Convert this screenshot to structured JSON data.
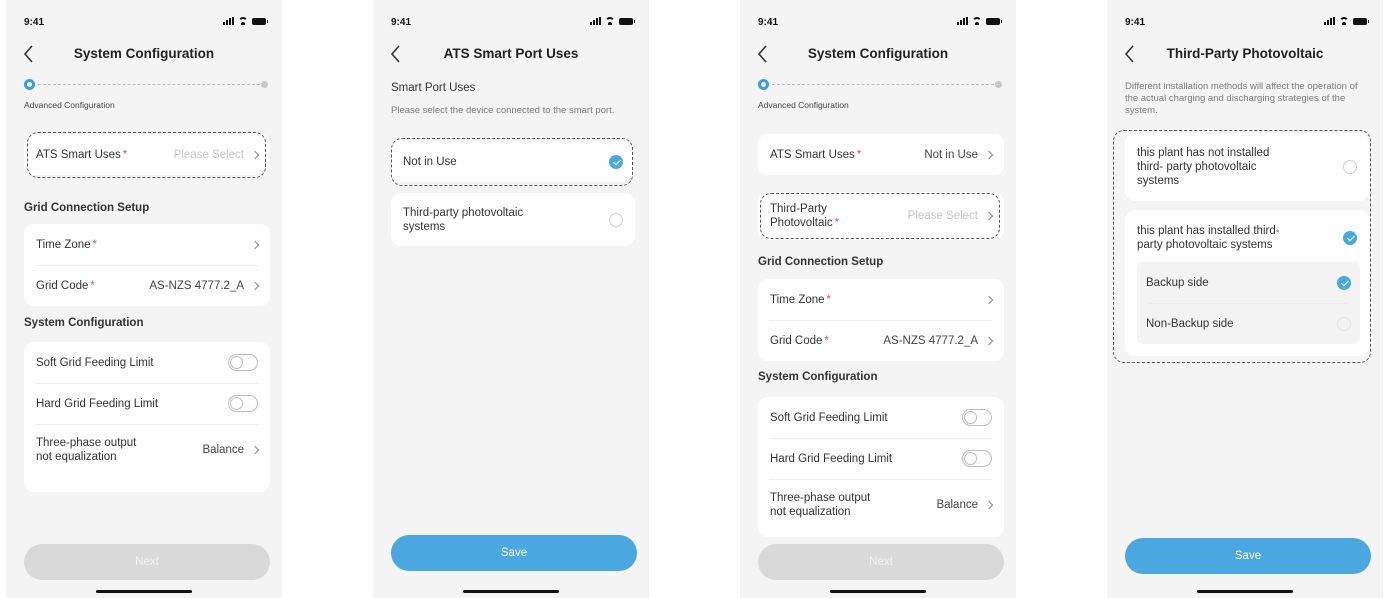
{
  "status": {
    "time": "9:41"
  },
  "screen1": {
    "title": "System Configuration",
    "step_label": "Advanced Configuration",
    "ats": {
      "label": "ATS Smart Uses",
      "required": "*",
      "value": "Please Select"
    },
    "grid_section": "Grid Connection Setup",
    "time_zone": {
      "label": "Time Zone",
      "required": "*",
      "value": ""
    },
    "grid_code": {
      "label": "Grid Code",
      "required": "*",
      "value": "AS-NZS 4777.2_A"
    },
    "sys_section": "System Configuration",
    "soft_limit": {
      "label": "Soft Grid Feeding Limit",
      "enabled": false
    },
    "hard_limit": {
      "label": "Hard Grid Feeding Limit",
      "enabled": false
    },
    "three_phase": {
      "label_line1": "Three-phase output",
      "label_line2": "not equalization",
      "value": "Balance"
    },
    "next_button": "Next"
  },
  "screen2": {
    "title": "ATS Smart Port Uses",
    "section": "Smart Port Uses",
    "description": "Please select the device connected to the smart port.",
    "options": [
      {
        "label": "Not in Use",
        "selected": true
      },
      {
        "label_line1": "Third-party photovoltaic",
        "label_line2": "systems",
        "selected": false
      }
    ],
    "save_button": "Save"
  },
  "screen3": {
    "title": "System Configuration",
    "step_label": "Advanced Configuration",
    "ats": {
      "label": "ATS Smart Uses",
      "required": "*",
      "value": "Not in Use"
    },
    "tpv": {
      "label_line1": "Third-Party",
      "label_line2": "Photovoltaic",
      "required": "*",
      "value": "Please Select"
    },
    "grid_section": "Grid Connection Setup",
    "time_zone": {
      "label": "Time Zone",
      "required": "*",
      "value": ""
    },
    "grid_code": {
      "label": "Grid Code",
      "required": "*",
      "value": "AS-NZS 4777.2_A"
    },
    "sys_section": "System Configuration",
    "soft_limit": {
      "label": "Soft Grid Feeding Limit",
      "enabled": false
    },
    "hard_limit": {
      "label": "Hard Grid Feeding Limit",
      "enabled": false
    },
    "three_phase": {
      "label_line1": "Three-phase output",
      "label_line2": "not equalization",
      "value": "Balance"
    },
    "next_button": "Next"
  },
  "screen4": {
    "title": "Third-Party Photovoltaic",
    "description": "Different installation methods will affect the operation of the actual charging and discharging strategies of the system.",
    "option_not_installed": {
      "line1": "this plant has not installed",
      "line2": "third- party photovoltaic",
      "line3": "systems",
      "selected": false
    },
    "option_installed": {
      "line1": "this plant has  installed third-",
      "line2": "party photovoltaic systems",
      "selected": true
    },
    "sub_options": [
      {
        "label": "Backup side",
        "selected": true
      },
      {
        "label": "Non-Backup side",
        "selected": false
      }
    ],
    "save_button": "Save"
  },
  "colors": {
    "accent": "#4aa7e0",
    "required": "#e0505a",
    "background": "#f4f4f5"
  }
}
